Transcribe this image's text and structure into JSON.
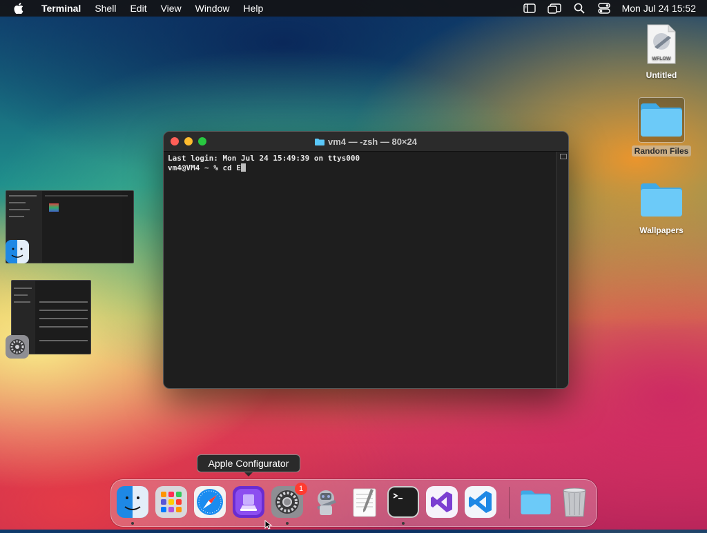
{
  "menubar": {
    "app_name": "Terminal",
    "menus": [
      "Shell",
      "Edit",
      "View",
      "Window",
      "Help"
    ],
    "clock": "Mon Jul 24  15:52",
    "status_icons": [
      "sidebar-icon",
      "stage-manager-icon",
      "search-icon",
      "control-center-icon"
    ]
  },
  "desktop": {
    "icons": [
      {
        "label": "Untitled",
        "subtext": "WFLOW",
        "type": "document"
      },
      {
        "label": "Random Files",
        "type": "folder",
        "selected": true
      },
      {
        "label": "Wallpapers",
        "type": "folder"
      }
    ]
  },
  "terminal": {
    "title": "vm4 — -zsh — 80×24",
    "lines": [
      "Last login: Mon Jul 24 15:49:39 on ttys000",
      "vm4@VM4 ~ % cd E"
    ]
  },
  "tooltip": "Apple Configurator",
  "dock": {
    "items": [
      {
        "name": "Finder",
        "icon": "finder-icon",
        "running": true
      },
      {
        "name": "Launchpad",
        "icon": "launchpad-icon",
        "running": false
      },
      {
        "name": "Safari",
        "icon": "safari-icon",
        "running": false
      },
      {
        "name": "Apple Configurator",
        "icon": "apple-configurator-icon",
        "running": false
      },
      {
        "name": "System Settings",
        "icon": "system-settings-icon",
        "running": true,
        "badge": "1"
      },
      {
        "name": "Automator",
        "icon": "automator-icon",
        "running": false
      },
      {
        "name": "TextEdit",
        "icon": "textedit-icon",
        "running": false
      },
      {
        "name": "Terminal",
        "icon": "terminal-icon",
        "running": true
      },
      {
        "name": "Visual Studio",
        "icon": "visual-studio-icon",
        "running": false
      },
      {
        "name": "Visual Studio Code",
        "icon": "vscode-icon",
        "running": false
      },
      {
        "name": "Downloads",
        "icon": "folder-icon",
        "running": false
      },
      {
        "name": "Trash",
        "icon": "trash-icon",
        "running": false
      }
    ]
  },
  "colors": {
    "menubar_bg": "#141416",
    "terminal_bg": "#1e1e1e",
    "folder_blue": "#5ac8fa",
    "badge_red": "#ff3b30"
  }
}
